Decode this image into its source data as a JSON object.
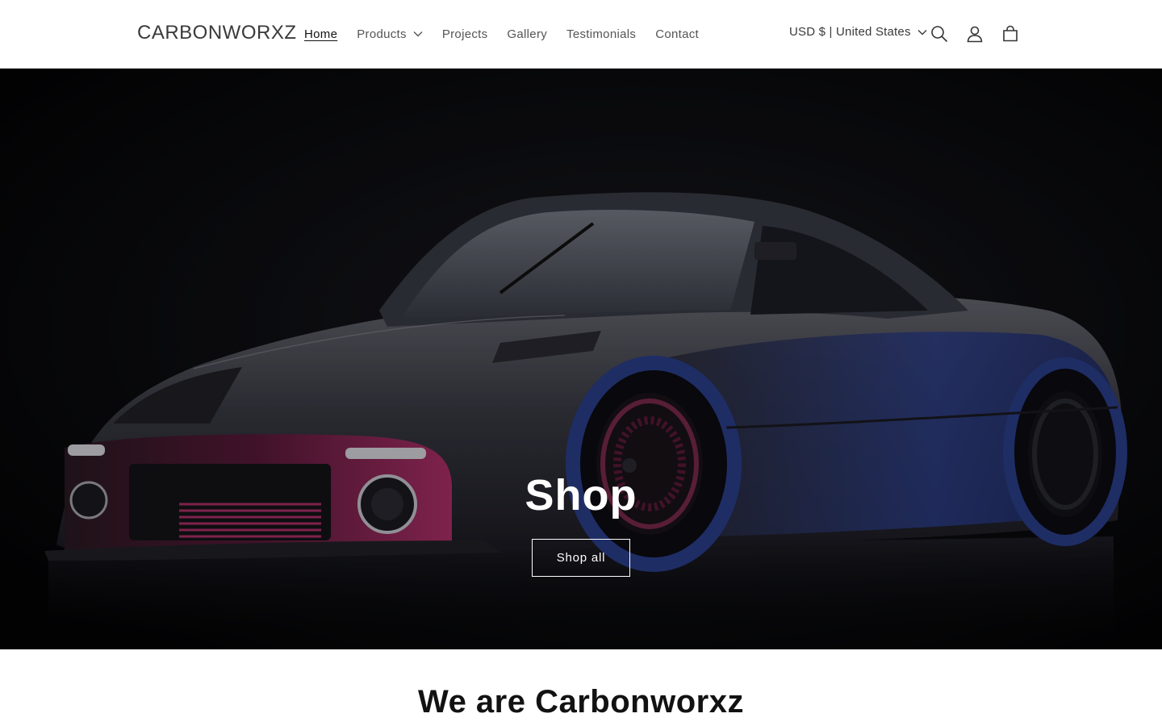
{
  "header": {
    "logo": "CARBONWORXZ",
    "nav": [
      {
        "label": "Home",
        "active": true
      },
      {
        "label": "Products",
        "dropdown": true
      },
      {
        "label": "Projects"
      },
      {
        "label": "Gallery"
      },
      {
        "label": "Testimonials"
      },
      {
        "label": "Contact"
      }
    ],
    "currency": "USD $ | United States",
    "icons": [
      "search-icon",
      "account-icon",
      "cart-icon"
    ]
  },
  "hero": {
    "title": "Shop",
    "button_label": "Shop all",
    "image": "dark-widebody-sports-car"
  },
  "about": {
    "title": "We are Carbonworxz"
  },
  "colors": {
    "text": "#121212",
    "background": "#ffffff",
    "hero_bg": "#050507",
    "car_body": "#3a3a44",
    "accent_magenta": "#b0306a",
    "accent_blue": "#2c3f8c"
  }
}
